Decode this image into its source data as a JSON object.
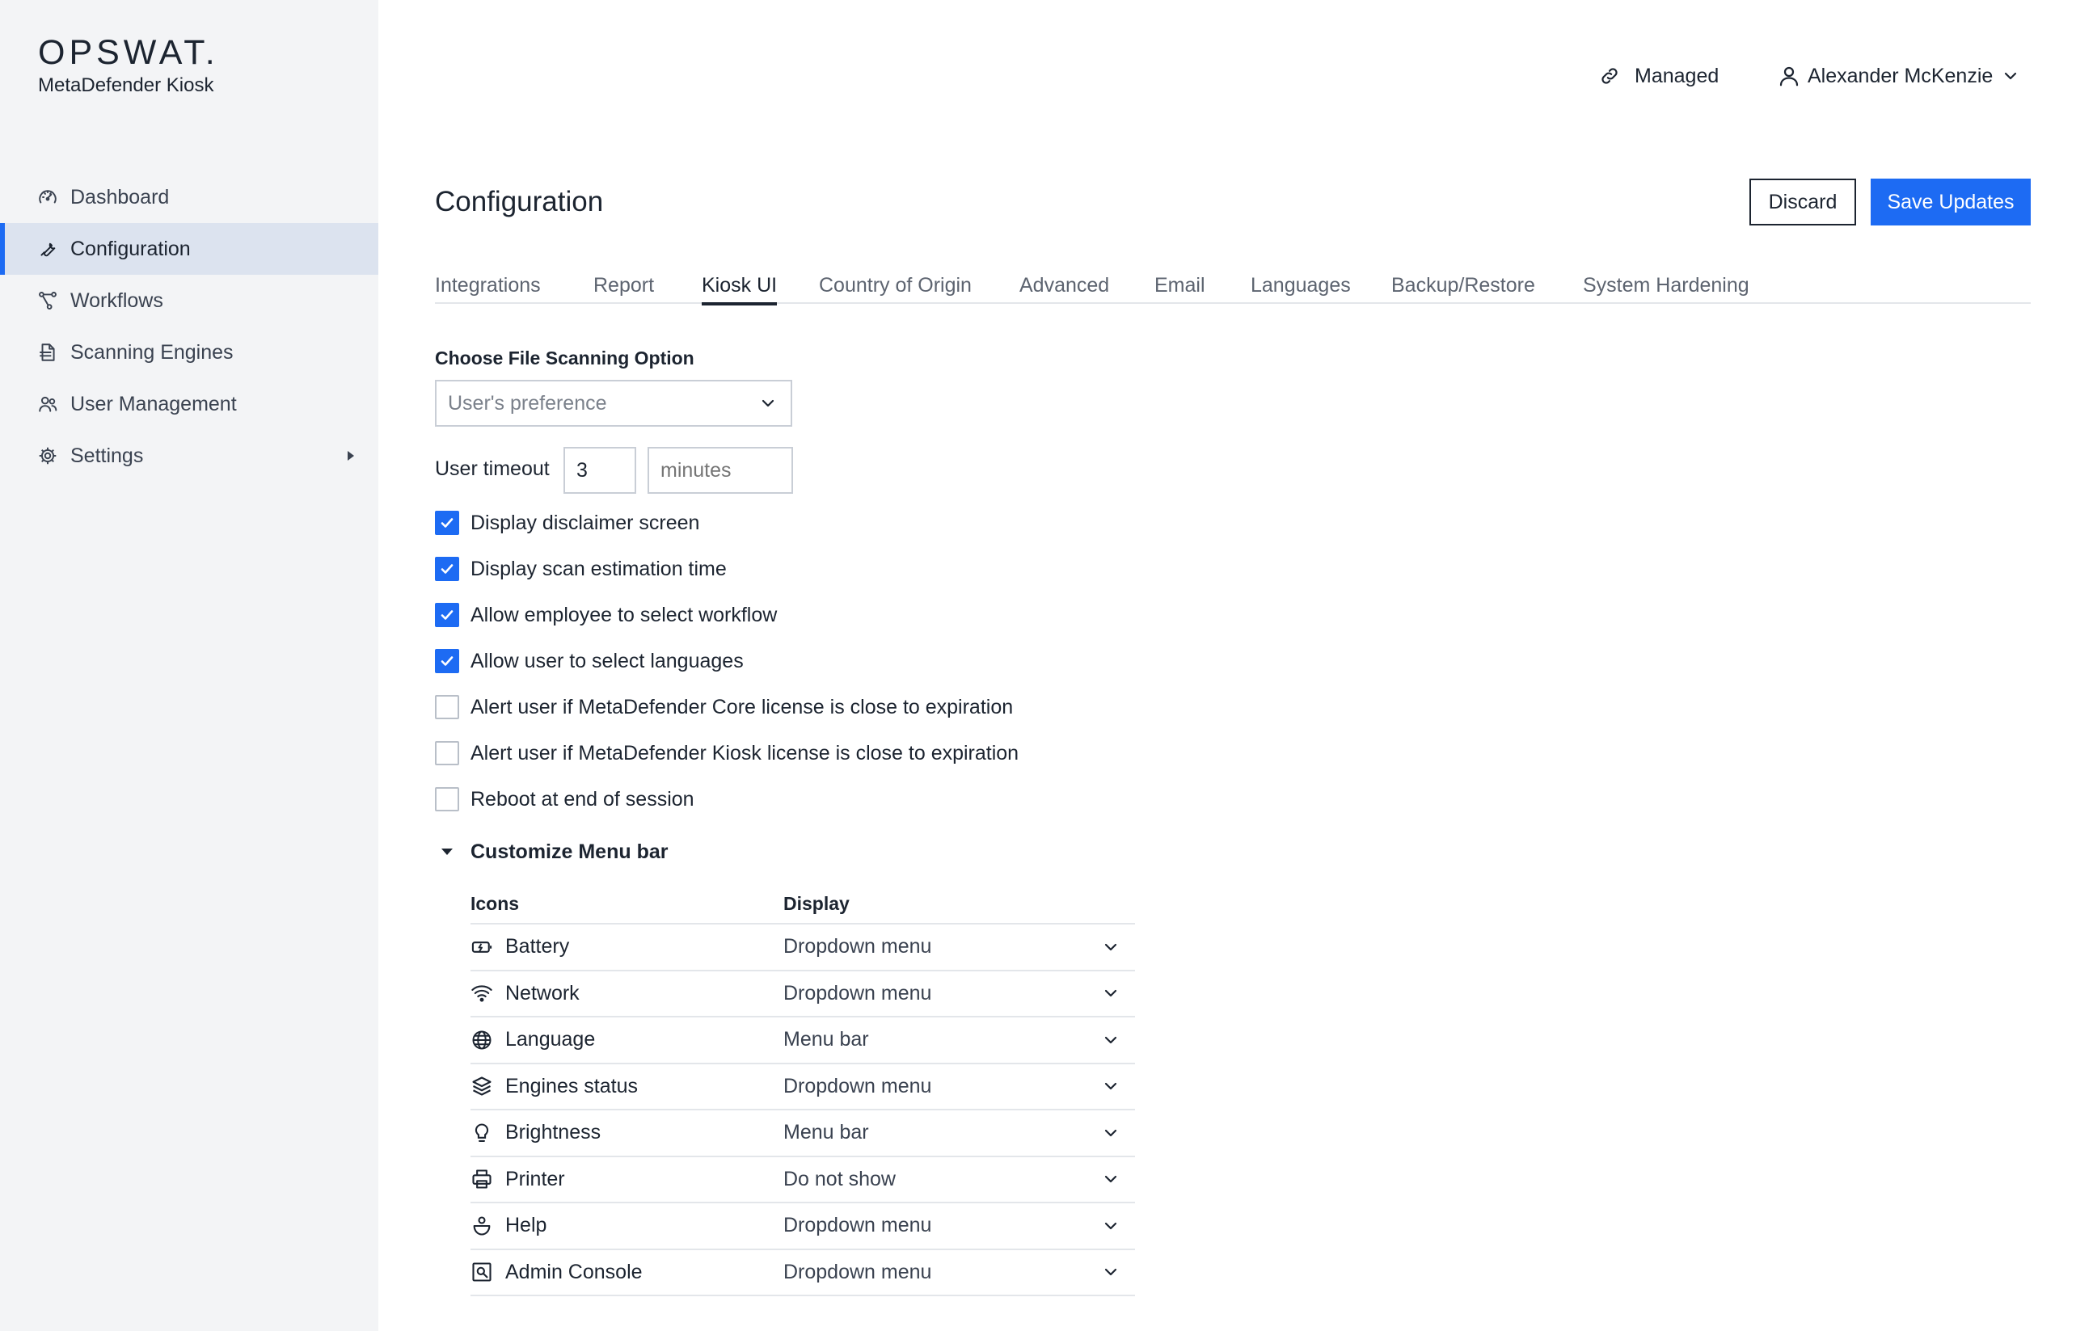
{
  "app": {
    "brand": "OPSWAT.",
    "product": "MetaDefender Kiosk"
  },
  "sidebar": {
    "items": [
      {
        "label": "Dashboard",
        "icon": "dashboard-icon"
      },
      {
        "label": "Configuration",
        "icon": "wrench-icon",
        "active": true
      },
      {
        "label": "Workflows",
        "icon": "workflow-icon"
      },
      {
        "label": "Scanning Engines",
        "icon": "engines-icon"
      },
      {
        "label": "User Management",
        "icon": "users-icon"
      },
      {
        "label": "Settings",
        "icon": "gear-icon",
        "expandable": true
      }
    ]
  },
  "topbar": {
    "managed_label": "Managed",
    "user_name": "Alexander McKenzie"
  },
  "header": {
    "title": "Configuration",
    "discard_label": "Discard",
    "save_label": "Save Updates"
  },
  "tabs": [
    {
      "label": "Integrations"
    },
    {
      "label": "Report"
    },
    {
      "label": "Kiosk UI",
      "active": true
    },
    {
      "label": "Country of Origin"
    },
    {
      "label": "Advanced"
    },
    {
      "label": "Email"
    },
    {
      "label": "Languages"
    },
    {
      "label": "Backup/Restore"
    },
    {
      "label": "System Hardening"
    }
  ],
  "form": {
    "scan_option_label": "Choose File Scanning Option",
    "scan_option_value": "User's preference",
    "timeout_label": "User timeout",
    "timeout_value": "3",
    "timeout_unit_placeholder": "minutes",
    "checkboxes": [
      {
        "label": "Display disclaimer screen",
        "checked": true
      },
      {
        "label": "Display scan estimation time",
        "checked": true
      },
      {
        "label": "Allow employee to select workflow",
        "checked": true
      },
      {
        "label": "Allow user to select languages",
        "checked": true
      },
      {
        "label": "Alert user if MetaDefender Core license is close to expiration",
        "checked": false
      },
      {
        "label": "Alert user if MetaDefender Kiosk license is close to expiration",
        "checked": false
      },
      {
        "label": "Reboot at end of session",
        "checked": false
      }
    ],
    "menu_section_label": "Customize Menu bar"
  },
  "menu_table": {
    "col_icons": "Icons",
    "col_display": "Display",
    "rows": [
      {
        "name": "Battery",
        "display": "Dropdown menu",
        "icon": "battery-icon"
      },
      {
        "name": "Network",
        "display": "Dropdown menu",
        "icon": "wifi-icon"
      },
      {
        "name": "Language",
        "display": "Menu bar",
        "icon": "globe-icon"
      },
      {
        "name": "Engines status",
        "display": "Dropdown menu",
        "icon": "layers-icon"
      },
      {
        "name": "Brightness",
        "display": "Menu bar",
        "icon": "bulb-icon"
      },
      {
        "name": "Printer",
        "display": "Do not show",
        "icon": "printer-icon"
      },
      {
        "name": "Help",
        "display": "Dropdown menu",
        "icon": "help-icon"
      },
      {
        "name": "Admin Console",
        "display": "Dropdown menu",
        "icon": "admin-console-icon"
      }
    ]
  },
  "colors": {
    "accent": "#1d6bf3",
    "sidebar_bg": "#f3f4f6",
    "sidebar_active_bg": "#dce3ef",
    "text": "#1c2430"
  }
}
